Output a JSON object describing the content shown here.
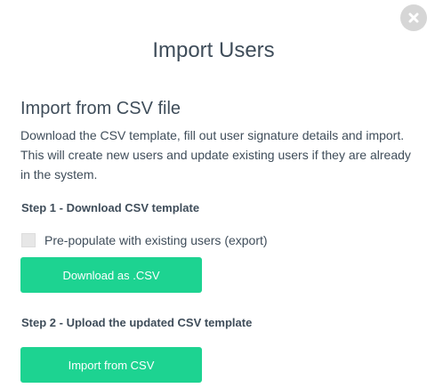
{
  "modal": {
    "title": "Import Users",
    "close_icon": "close-icon"
  },
  "csv_section": {
    "heading": "Import from CSV file",
    "description": "Download the CSV template, fill out user signature details and import. This will create new users and update existing users if they are already in the system."
  },
  "step1": {
    "heading": "Step 1 - Download CSV template",
    "checkbox_label": "Pre-populate with existing users (export)",
    "checkbox_checked": false,
    "button_label": "Download as .CSV"
  },
  "step2": {
    "heading": "Step 2 - Upload the updated CSV template",
    "button_label": "Import from CSV"
  },
  "colors": {
    "accent": "#1dd391",
    "text": "#3f4d5a",
    "close_bg": "#d6d6d6"
  }
}
